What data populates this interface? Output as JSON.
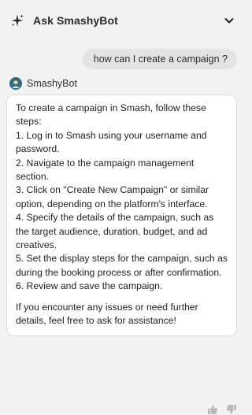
{
  "header": {
    "title": "Ask SmashyBot",
    "icon": "sparkle-icon",
    "toggle_icon": "chevron-down-icon"
  },
  "conversation": {
    "user_message": "how can I create a campaign ?",
    "bot": {
      "name": "SmashyBot",
      "avatar_color": "#2f6e86"
    },
    "answer_lines": [
      "To create a campaign in Smash, follow these steps:",
      "1. Log in to Smash using your username and password.",
      "2. Navigate to the campaign management section.",
      "3. Click on \"Create New Campaign\" or similar option, depending on the platform's interface.",
      "4. Specify the details of the campaign, such as the target audience, duration, budget, and ad creatives.",
      "5. Set the display steps for the campaign, such as during the booking process or after confirmation.",
      "6. Review and save the campaign."
    ],
    "answer_closing": "If you encounter any issues or need further details, feel free to ask for assistance!"
  },
  "feedback": {
    "like_icon": "thumbs-up-icon",
    "dislike_icon": "thumbs-down-icon"
  }
}
